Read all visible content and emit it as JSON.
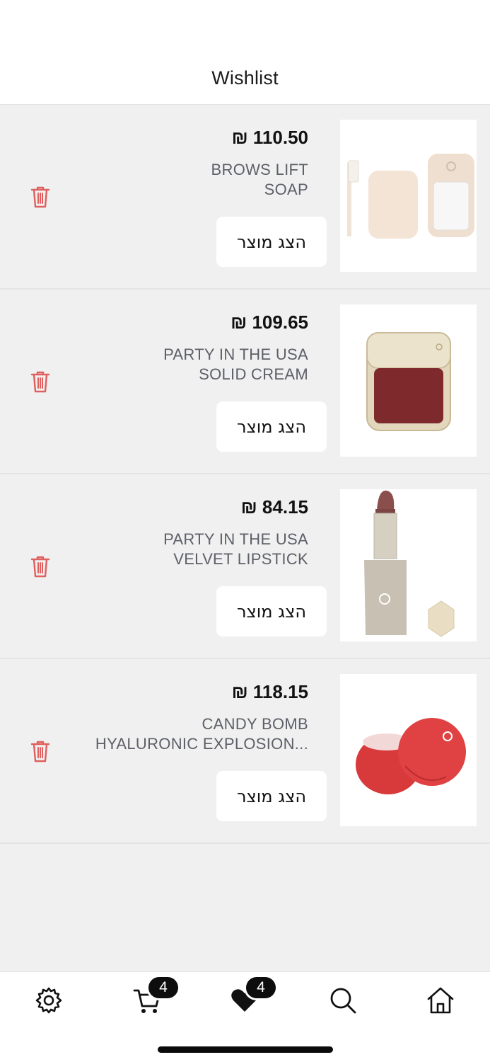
{
  "header": {
    "title": "Wishlist"
  },
  "items": [
    {
      "price": "₪ 110.50",
      "name_line1": "BROWS LIFT",
      "name_line2": "SOAP",
      "button": "הצג מוצר"
    },
    {
      "price": "₪ 109.65",
      "name_line1": "PARTY IN THE USA",
      "name_line2": "SOLID CREAM",
      "button": "הצג מוצר"
    },
    {
      "price": "₪ 84.15",
      "name_line1": "PARTY IN THE USA",
      "name_line2": "VELVET LIPSTICK",
      "button": "הצג מוצר"
    },
    {
      "price": "₪ 118.15",
      "name_line1": "CANDY BOMB",
      "name_line2": "HYALURONIC EXPLOSION...",
      "button": "הצג מוצר"
    }
  ],
  "tabbar": {
    "cart_count": "4",
    "wishlist_count": "4"
  },
  "colors": {
    "trash": "#e05f5f",
    "background": "#f0f0f0",
    "badge": "#0d0d0d"
  }
}
